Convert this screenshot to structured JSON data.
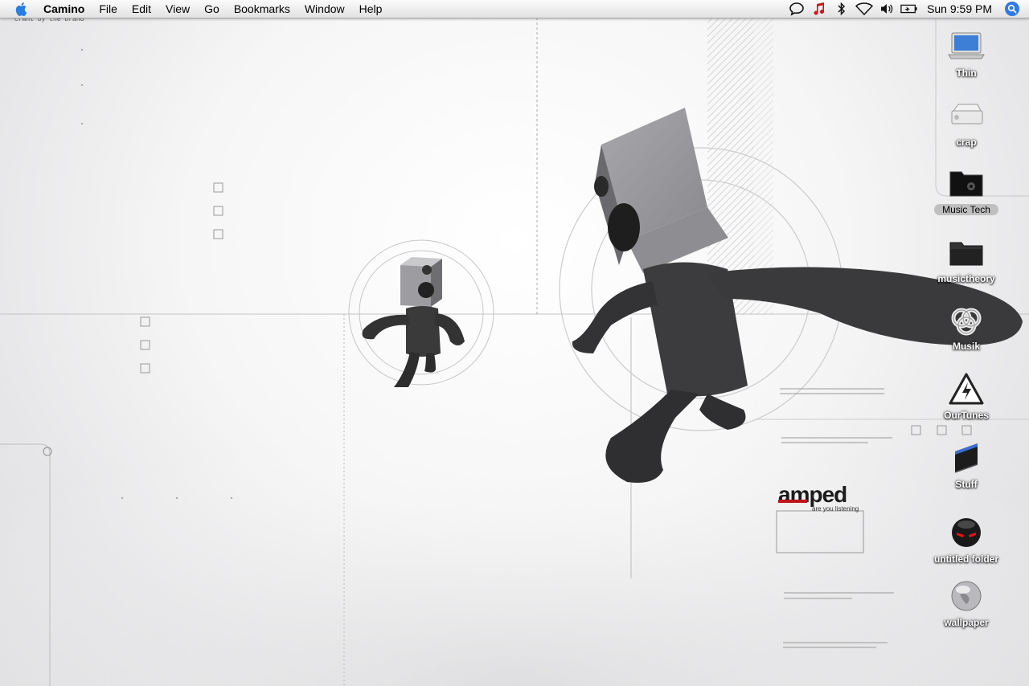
{
  "menubar": {
    "app_name": "Camino",
    "items": [
      "File",
      "Edit",
      "View",
      "Go",
      "Bookmarks",
      "Window",
      "Help"
    ],
    "status_icons": [
      "chat-icon",
      "itunes-note-icon",
      "bluetooth-icon",
      "wifi-icon",
      "volume-icon",
      "battery-icon"
    ],
    "clock": "Sun 9:59 PM"
  },
  "wallpaper": {
    "caption_top": "crmnt by the brand",
    "logo_text": "amped",
    "logo_tagline": "are you listening",
    "accent_color": "#c0141b"
  },
  "desktop_icons": [
    {
      "label": "Thin",
      "icon": "laptop-icon"
    },
    {
      "label": "crap",
      "icon": "external-drive-icon"
    },
    {
      "label": "Music Tech",
      "icon": "black-folder-icon",
      "selected": true
    },
    {
      "label": "musictheory",
      "icon": "dark-folder-icon"
    },
    {
      "label": "Musik",
      "icon": "knot-icon"
    },
    {
      "label": "OurTunes",
      "icon": "high-voltage-icon"
    },
    {
      "label": "Stuff",
      "icon": "book-folder-icon"
    },
    {
      "label": "untitled folder",
      "icon": "red-eyed-ball-icon"
    },
    {
      "label": "wallpaper",
      "icon": "silver-globe-icon"
    }
  ]
}
